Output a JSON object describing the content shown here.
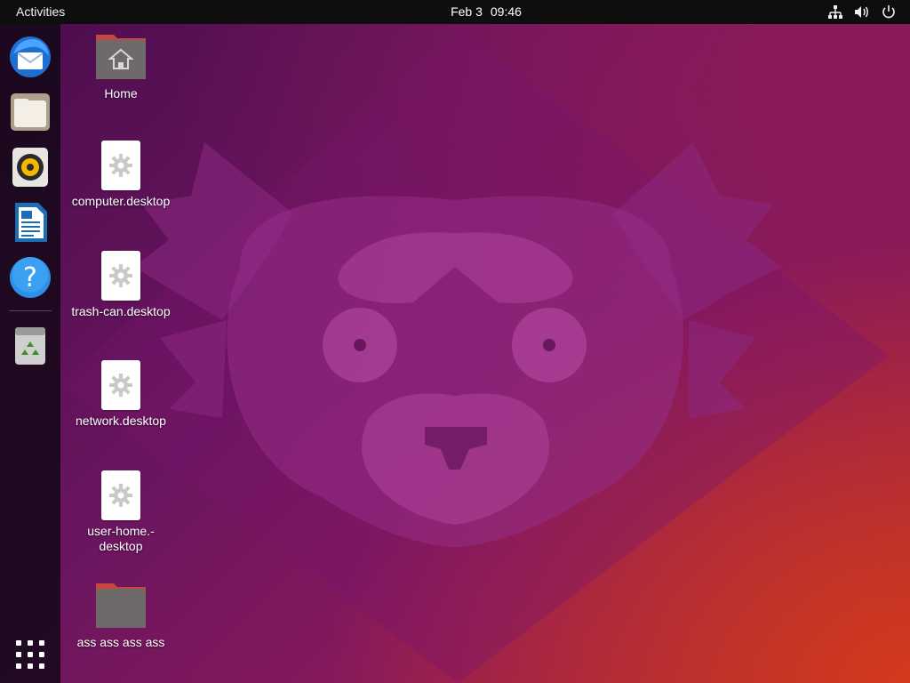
{
  "topbar": {
    "activities": "Activities",
    "date": "Feb 3",
    "time": "09:46",
    "tray_icons": [
      "network-icon",
      "volume-icon",
      "power-icon"
    ]
  },
  "dock": {
    "items": [
      {
        "name": "thunderbird-icon"
      },
      {
        "name": "files-icon"
      },
      {
        "name": "rhythmbox-icon"
      },
      {
        "name": "libreoffice-writer-icon"
      },
      {
        "name": "help-icon",
        "glyph": "?"
      },
      {
        "name": "trash-icon"
      }
    ],
    "apps_grid": "show-applications-icon"
  },
  "desktop": {
    "icons": [
      {
        "label": "Home",
        "type": "home-folder"
      },
      {
        "label": "computer.desktop",
        "type": "launcher"
      },
      {
        "label": "trash-can.desktop",
        "type": "launcher"
      },
      {
        "label": "network.desktop",
        "type": "launcher"
      },
      {
        "label": "user-home.-\ndesktop",
        "type": "launcher"
      },
      {
        "label": "ass ass ass ass",
        "type": "folder"
      }
    ]
  },
  "colors": {
    "topbar": "#0e0e0e",
    "wallpaper_primary": "#6b1560",
    "wallpaper_accent": "#d23a1c",
    "folder": "#6f6a6a",
    "folder_tab": "#c7463f"
  }
}
